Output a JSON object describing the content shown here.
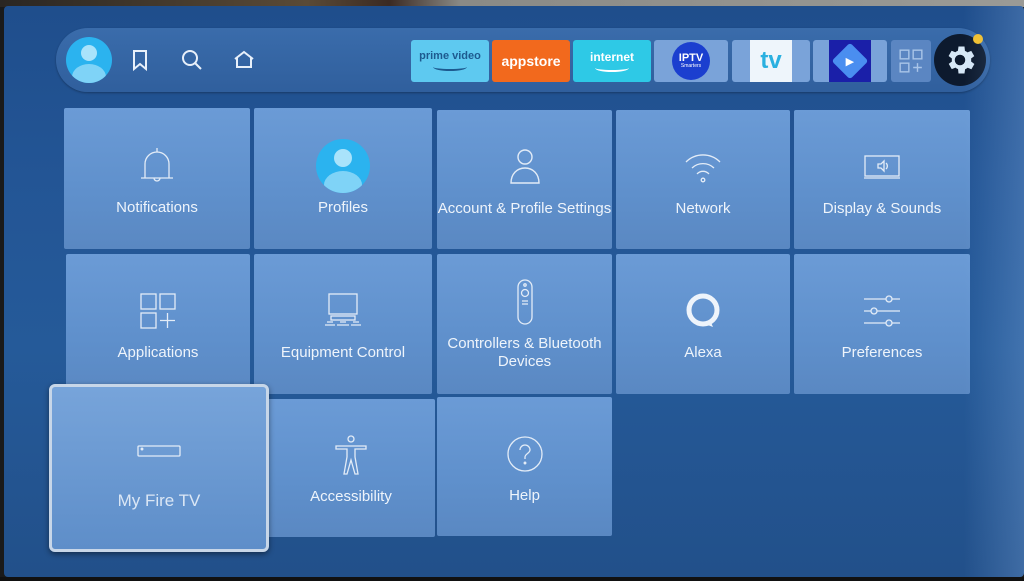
{
  "topbar": {
    "profile_icon": "profile-avatar-icon",
    "nav": [
      {
        "name": "bookmark",
        "icon": "bookmark-icon"
      },
      {
        "name": "search",
        "icon": "search-icon"
      },
      {
        "name": "home",
        "icon": "home-icon"
      }
    ],
    "apps": [
      {
        "id": "prime-video",
        "label": "prime video",
        "color": "#5ec9f0"
      },
      {
        "id": "appstore",
        "label": "appstore",
        "color": "#f2691d"
      },
      {
        "id": "internet",
        "label": "internet",
        "color": "#2ec9e6"
      },
      {
        "id": "iptv",
        "label": "IPTV",
        "sub": "Smarters"
      },
      {
        "id": "tv",
        "label": "tv"
      },
      {
        "id": "player",
        "label": "▶"
      },
      {
        "id": "all-apps",
        "label": "all-apps-grid-icon"
      }
    ],
    "settings": {
      "icon": "gear-icon",
      "has_notification": true,
      "notification_color": "#f5c12a"
    }
  },
  "settings_tiles": [
    {
      "label": "Notifications",
      "icon": "bell-icon"
    },
    {
      "label": "Profiles",
      "icon": "profile-avatar-icon"
    },
    {
      "label": "Account & Profile Settings",
      "icon": "person-icon"
    },
    {
      "label": "Network",
      "icon": "wifi-icon"
    },
    {
      "label": "Display & Sounds",
      "icon": "display-speaker-icon"
    },
    {
      "label": "Applications",
      "icon": "apps-grid-icon"
    },
    {
      "label": "Equipment Control",
      "icon": "tv-equipment-icon"
    },
    {
      "label": "Controllers & Bluetooth Devices",
      "icon": "remote-icon"
    },
    {
      "label": "Alexa",
      "icon": "alexa-ring-icon"
    },
    {
      "label": "Preferences",
      "icon": "sliders-icon"
    },
    {
      "label": "My Fire TV",
      "icon": "fire-tv-device-icon",
      "focused": true
    },
    {
      "label": "Accessibility",
      "icon": "accessibility-icon"
    },
    {
      "label": "Help",
      "icon": "help-circle-icon"
    }
  ]
}
